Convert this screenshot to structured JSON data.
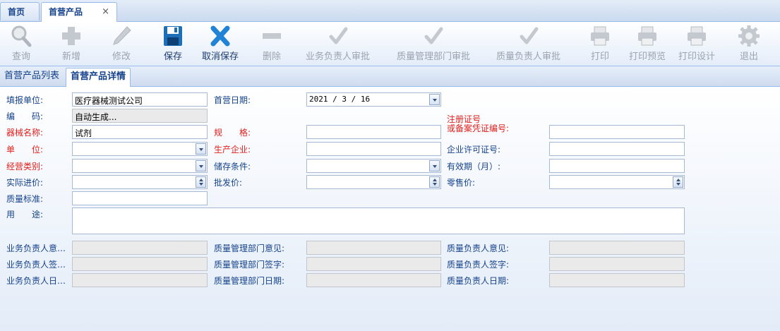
{
  "tabs": [
    {
      "label": "首页"
    },
    {
      "label": "首营产品",
      "close": "×"
    }
  ],
  "toolbar": {
    "query": "查询",
    "add": "新增",
    "edit": "修改",
    "save": "保存",
    "cancel_save": "取消保存",
    "delete": "删除",
    "biz_approve": "业务负责人审批",
    "qa_dept_approve": "质量管理部门审批",
    "qa_head_approve": "质量负责人审批",
    "print": "打印",
    "print_preview": "打印预览",
    "print_design": "打印设计",
    "exit": "退出"
  },
  "subtabs": [
    {
      "label": "首营产品列表"
    },
    {
      "label": "首营产品详情"
    }
  ],
  "form": {
    "unit_label": "填报单位:",
    "unit_value": "医疗器械测试公司",
    "date_label": "首营日期:",
    "date_value": "2021 / 3 / 16",
    "code_label": "编　　码:",
    "code_value": "自动生成...",
    "device_name_label": "器械名称:",
    "device_name_value": "试剂",
    "spec_label": "规　　格:",
    "spec_value": "",
    "reg_no_label_1": "注册证号",
    "reg_no_label_2": "或备案凭证编号:",
    "reg_no_value": "",
    "uom_label": "单　　位:",
    "uom_value": "",
    "manufacturer_label": "生产企业:",
    "manufacturer_value": "",
    "license_label": "企业许可证号:",
    "license_value": "",
    "category_label": "经营类别:",
    "category_value": "",
    "storage_label": "储存条件:",
    "storage_value": "",
    "validity_label": "有效期（月）:",
    "validity_value": "",
    "purchase_price_label": "实际进价:",
    "purchase_price_value": "",
    "wholesale_label": "批发价:",
    "wholesale_value": "",
    "retail_label": "零售价:",
    "retail_value": "",
    "quality_std_label": "质量标准:",
    "quality_std_value": "",
    "usage_label": "用　　途:",
    "usage_value": "",
    "biz_opinion_label": "业务负责人意…",
    "qa_dept_opinion_label": "质量管理部门意见:",
    "qa_head_opinion_label": "质量负责人意见:",
    "biz_sign_label": "业务负责人签…",
    "qa_dept_sign_label": "质量管理部门签字:",
    "qa_head_sign_label": "质量负责人签字:",
    "biz_date_label": "业务负责人日…",
    "qa_dept_date_label": "质量管理部门日期:",
    "qa_head_date_label": "质量负责人日期:"
  },
  "colors": {
    "required_label": "#e0201c",
    "label": "#15428b",
    "border": "#99bbe8"
  }
}
